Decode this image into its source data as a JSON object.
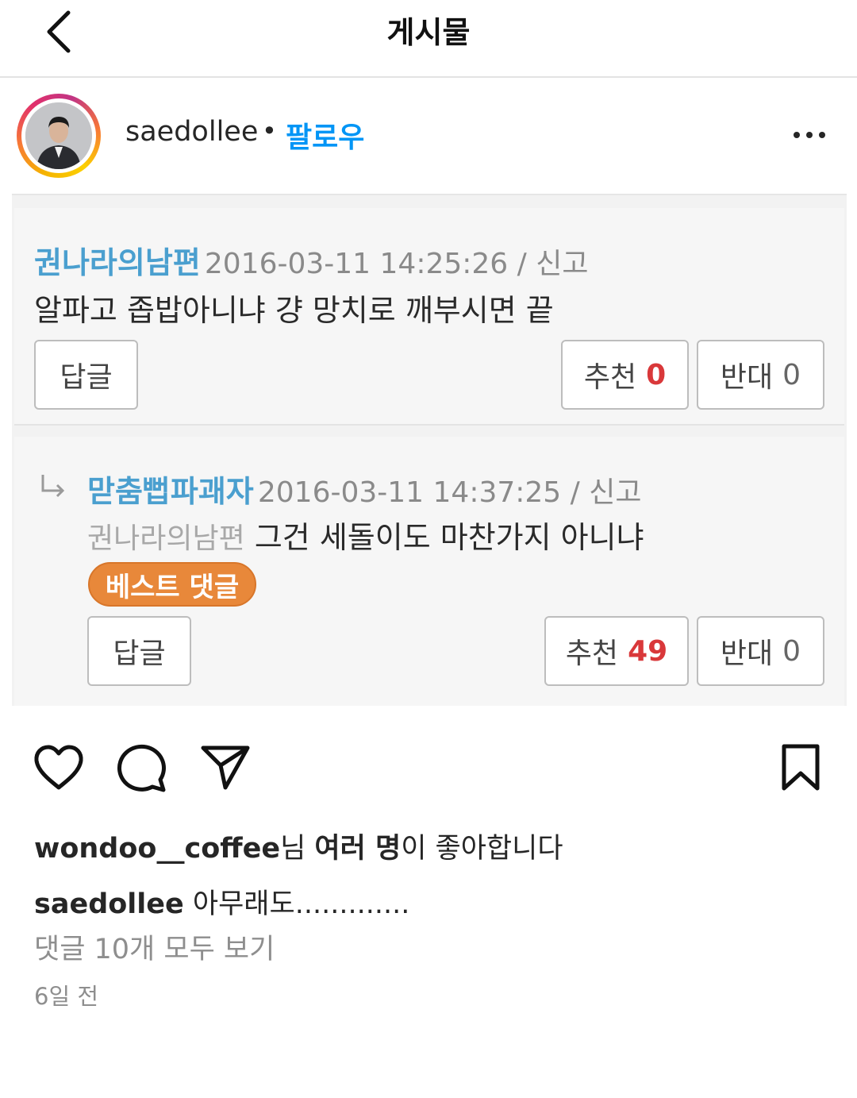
{
  "header": {
    "title": "게시물",
    "back_icon": "chevron-left-icon"
  },
  "post": {
    "username": "saedollee",
    "separator": "•",
    "follow_label": "팔로우",
    "more_icon": "more-horizontal-icon"
  },
  "embedded": {
    "comment1": {
      "author": "권나라의남편",
      "meta": "2016-03-11 14:25:26 / 신고",
      "text": "알파고 좁밥아니냐 걍 망치로 깨부시면 끝",
      "reply_label": "답글",
      "up_label": "추천",
      "up_count": "0",
      "down_label": "반대",
      "down_count": "0"
    },
    "comment2": {
      "author": "맏춤뻡파괘자",
      "meta": "2016-03-11 14:37:25 / 신고",
      "mention": "권나라의남편",
      "text": "그건 세돌이도 마찬가지 아니냐",
      "badge": "베스트 댓글",
      "reply_label": "답글",
      "up_label": "추천",
      "up_count": "49",
      "down_label": "반대",
      "down_count": "0"
    }
  },
  "actions": {
    "like_icon": "heart-icon",
    "comment_icon": "comment-icon",
    "share_icon": "send-icon",
    "save_icon": "bookmark-icon"
  },
  "likes": {
    "user": "wondoo__coffee",
    "suffix1": "님 ",
    "bold": "여러 명",
    "suffix2": "이 좋아합니다"
  },
  "caption": {
    "user": "saedollee",
    "text": " 아무래도............."
  },
  "view_comments": "댓글 10개 모두 보기",
  "time_ago": "6일 전",
  "colors": {
    "follow": "#0095f6",
    "author": "#4a9fcf",
    "best_badge": "#e8883a",
    "count_red": "#d9383a"
  }
}
